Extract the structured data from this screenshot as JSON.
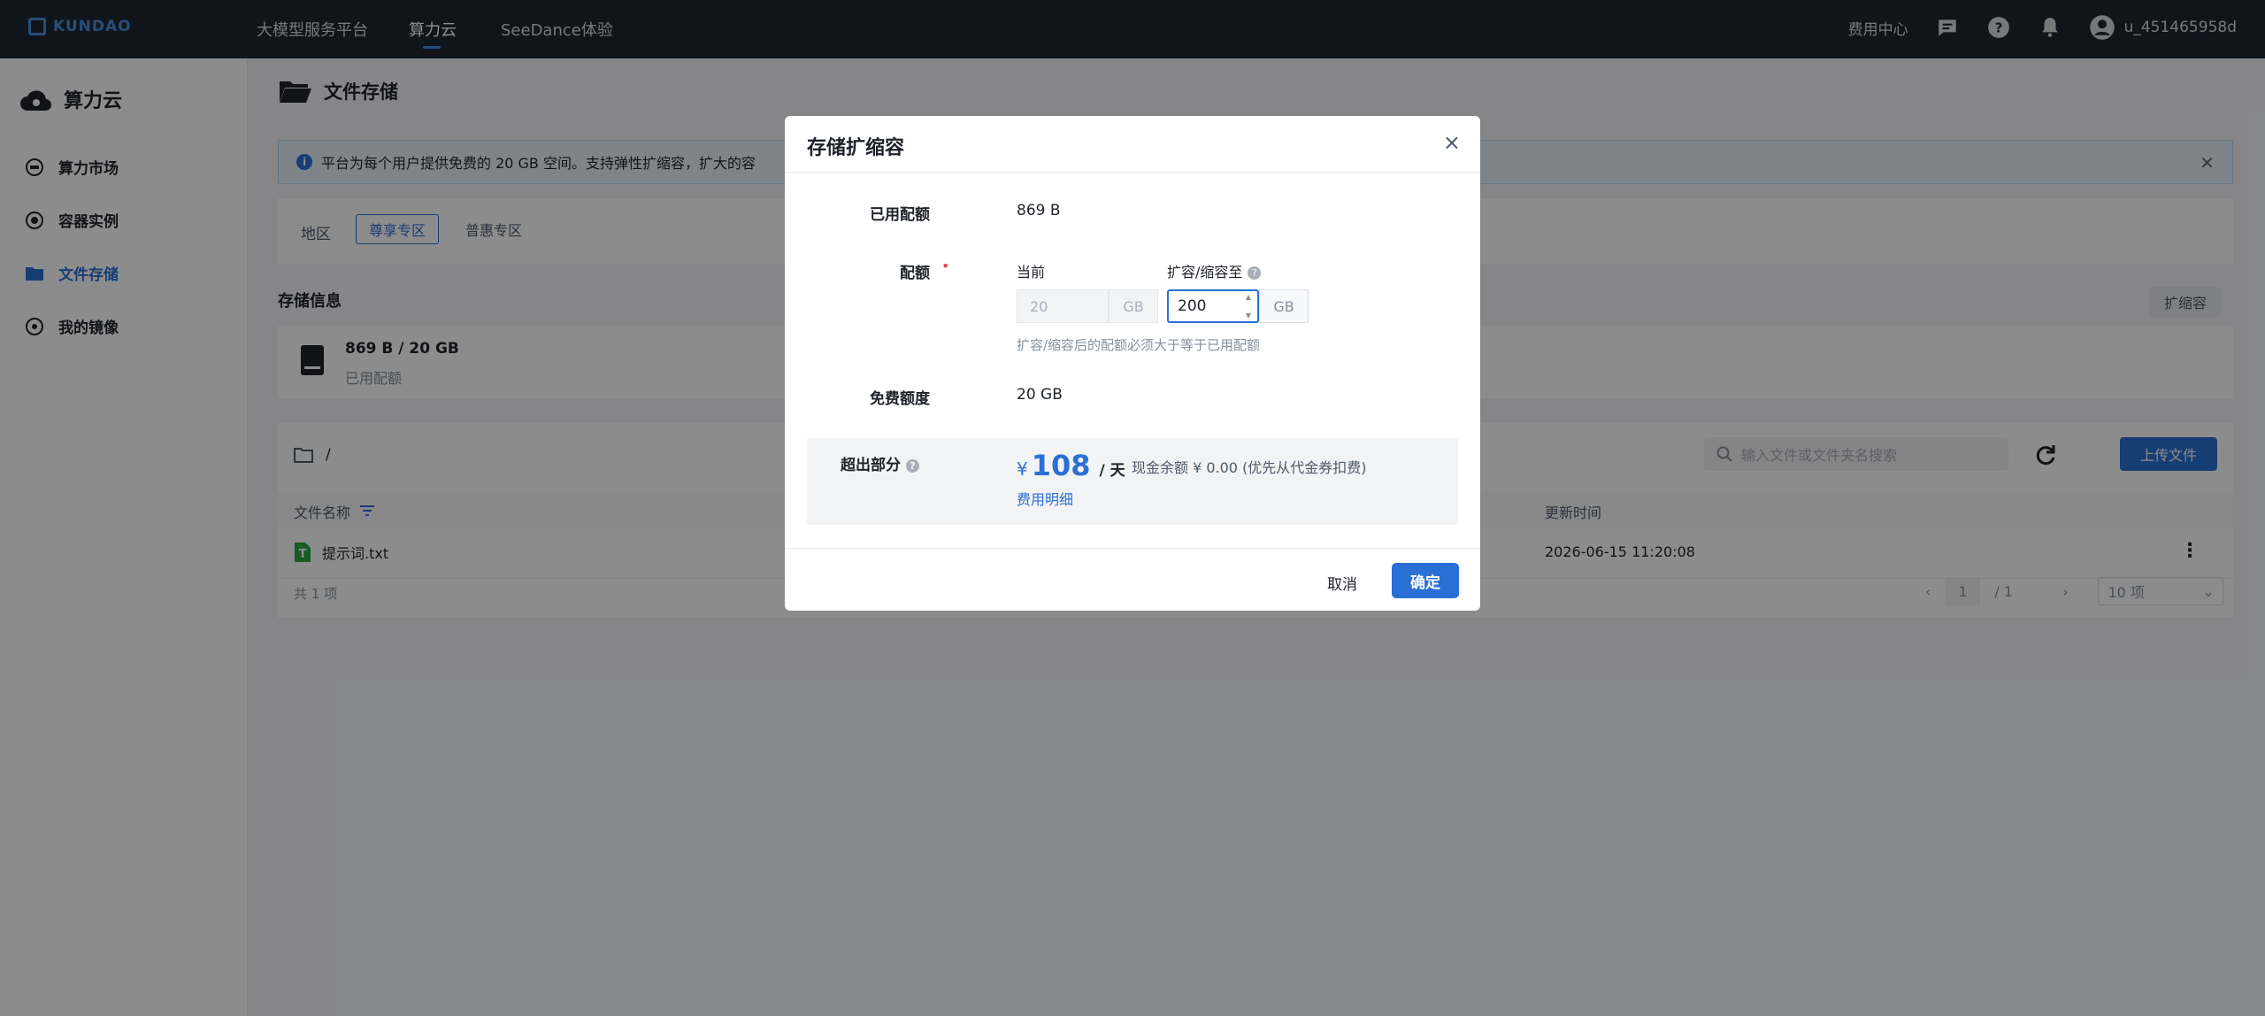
{
  "topnav": {
    "logo": "KUNDAO",
    "items": [
      "大模型服务平台",
      "算力云",
      "SeeDance体验"
    ],
    "fee_center": "费用中心",
    "username": "u_451465958d"
  },
  "sidebar": {
    "title": "算力云",
    "items": [
      "算力市场",
      "容器实例",
      "文件存储",
      "我的镜像"
    ]
  },
  "main": {
    "page_title": "文件存储",
    "alert": "平台为每个用户提供免费的 20 GB 空间。支持弹性扩缩容，扩大的容",
    "zone_label": "地区",
    "zones": [
      "尊享专区",
      "普惠专区"
    ],
    "storage_title": "存储信息",
    "expand_btn": "扩缩容",
    "storage_value": "869 B / 20 GB",
    "storage_sub": "已用配额",
    "path": "/",
    "search_placeholder": "输入文件或文件夹名搜索",
    "upload_btn": "上传文件",
    "col_name": "文件名称",
    "col_time": "更新时间",
    "rows": [
      {
        "name": "提示词.txt",
        "time": "2026-06-15 11:20:08"
      }
    ],
    "total": "共 1 项",
    "page_current": "1",
    "page_total": "/ 1",
    "page_size": "10 项"
  },
  "modal": {
    "title": "存储扩缩容",
    "used_label": "已用配额",
    "used_value": "869 B",
    "quota_label": "配额",
    "current_label": "当前",
    "current_value": "20",
    "unit": "GB",
    "resize_label": "扩容/缩容至",
    "resize_value": "200",
    "hint": "扩容/缩容后的配额必须大于等于已用配额",
    "free_label": "免费额度",
    "free_value": "20 GB",
    "over_label": "超出部分",
    "price_symbol": "¥",
    "price_amount": "108",
    "price_unit": "/ 天",
    "balance": "现金余额 ¥ 0.00  (优先从代金券扣费)",
    "fee_link": "费用明细",
    "cancel": "取消",
    "ok": "确定"
  },
  "colors": {
    "accent": "#2a6fd6",
    "nav_bg": "#1e2733"
  }
}
